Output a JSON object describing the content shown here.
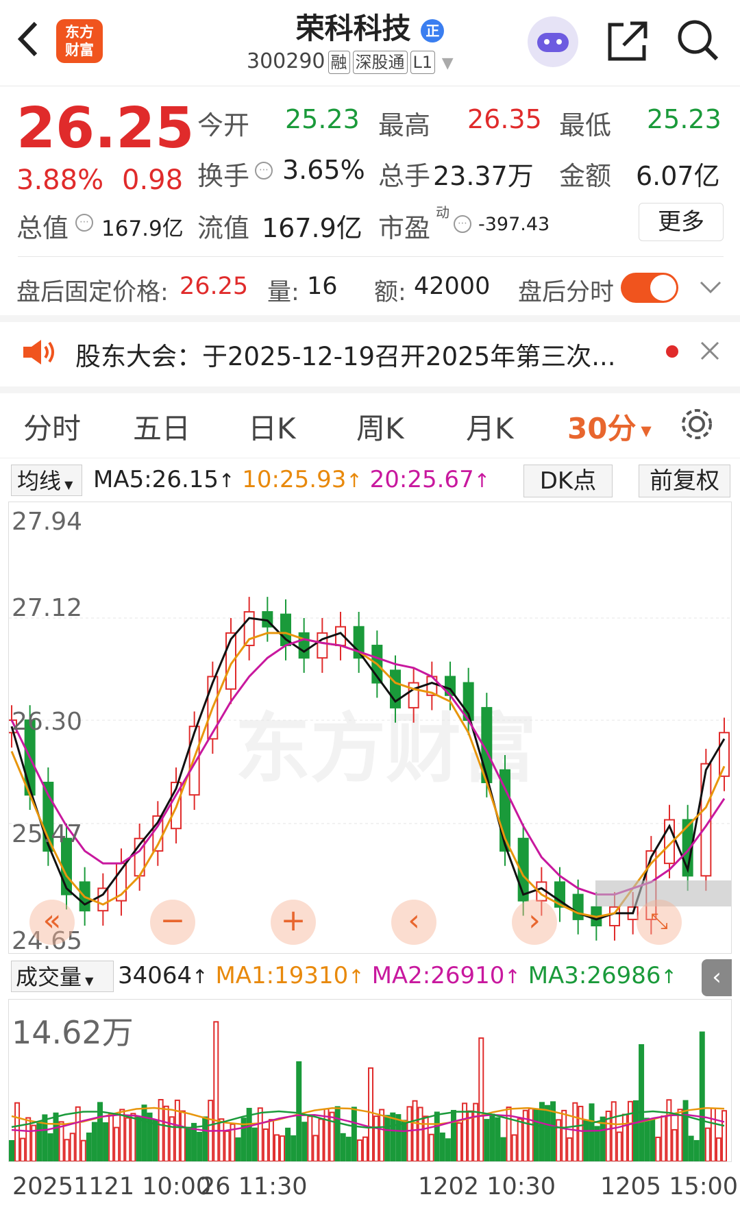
{
  "header": {
    "logo_text": "东方\n财富",
    "title": "荣科科技",
    "badge": "正",
    "code": "300290",
    "tags": [
      "融",
      "深股通",
      "L1"
    ]
  },
  "quote": {
    "price": "26.25",
    "change_pct": "3.88%",
    "change": "0.98",
    "open_label": "今开",
    "open": "25.23",
    "high_label": "最高",
    "high": "26.35",
    "low_label": "最低",
    "low": "25.23",
    "turnover_label": "换手",
    "turnover": "3.65%",
    "volume_label": "总手",
    "volume": "23.37万",
    "amount_label": "金额",
    "amount": "6.07亿",
    "mktcap_label": "总值",
    "mktcap": "167.9亿",
    "float_label": "流值",
    "float_cap": "167.9亿",
    "pe_label": "市盈",
    "pe_sup": "动",
    "pe": "-397.43",
    "more_button": "更多"
  },
  "after_hours": {
    "label": "盘后固定价格:",
    "price": "26.25",
    "vol_label": "量:",
    "vol": "16",
    "amt_label": "额:",
    "amt": "42000",
    "timeshare_label": "盘后分时"
  },
  "notice": {
    "text": "股东大会：于2025-12-19召开2025年第三次..."
  },
  "tabs": [
    "分时",
    "五日",
    "日K",
    "周K",
    "月K",
    "30分"
  ],
  "ma_bar": {
    "selector": "均线",
    "ma5": "MA5:26.15",
    "ma10": "10:25.93",
    "ma20": "20:25.67",
    "dk_button": "DK点",
    "adjust_button": "前复权"
  },
  "price_axis": [
    "27.94",
    "27.12",
    "26.30",
    "25.47",
    "24.65"
  ],
  "volume_bar": {
    "selector": "成交量",
    "vol": "34064",
    "ma1": "MA1:19310",
    "ma2": "MA2:26910",
    "ma3": "MA3:26986",
    "max_label": "14.62万"
  },
  "time_axis": [
    "20251121 10:00",
    "26 11:30",
    "1202 10:30",
    "1205 15:00"
  ],
  "watermark": "东方财富",
  "colors": {
    "up": "#e02b2b",
    "down": "#1a9a3a",
    "ma5": "#111111",
    "ma10": "#e8960c",
    "ma20": "#c8189e",
    "accent": "#e8662e"
  },
  "chart_data": {
    "type": "candlestick",
    "ylim": [
      24.65,
      27.94
    ],
    "series": [
      {
        "name": "MA5",
        "values": [
          26.25,
          25.75,
          25.3,
          24.95,
          24.82,
          24.9,
          25.1,
          25.3,
          25.48,
          25.75,
          26.2,
          26.6,
          26.95,
          27.12,
          27.1,
          26.95,
          26.85,
          26.95,
          27.0,
          26.85,
          26.65,
          26.45,
          26.55,
          26.6,
          26.55,
          26.35,
          25.85,
          25.3,
          24.9,
          24.95,
          24.85,
          24.75,
          24.7,
          24.75,
          24.75,
          25.2,
          25.45,
          25.1,
          25.9,
          26.15
        ]
      },
      {
        "name": "10",
        "values": [
          26.05,
          25.7,
          25.35,
          25.05,
          24.88,
          24.82,
          24.9,
          25.05,
          25.3,
          25.6,
          26.0,
          26.4,
          26.75,
          26.95,
          27.0,
          27.0,
          26.95,
          26.92,
          26.9,
          26.85,
          26.75,
          26.6,
          26.55,
          26.52,
          26.45,
          26.2,
          25.8,
          25.35,
          25.05,
          24.9,
          24.82,
          24.75,
          24.72,
          24.75,
          24.95,
          25.15,
          25.3,
          25.45,
          25.6,
          25.93
        ]
      },
      {
        "name": "20",
        "values": [
          26.3,
          26.0,
          25.7,
          25.45,
          25.25,
          25.15,
          25.15,
          25.25,
          25.45,
          25.7,
          25.95,
          26.2,
          26.45,
          26.65,
          26.8,
          26.9,
          26.95,
          26.92,
          26.9,
          26.85,
          26.8,
          26.75,
          26.72,
          26.65,
          26.5,
          26.3,
          26.05,
          25.75,
          25.45,
          25.2,
          25.05,
          24.95,
          24.9,
          24.9,
          24.95,
          25.0,
          25.1,
          25.25,
          25.45,
          25.67
        ]
      }
    ]
  }
}
